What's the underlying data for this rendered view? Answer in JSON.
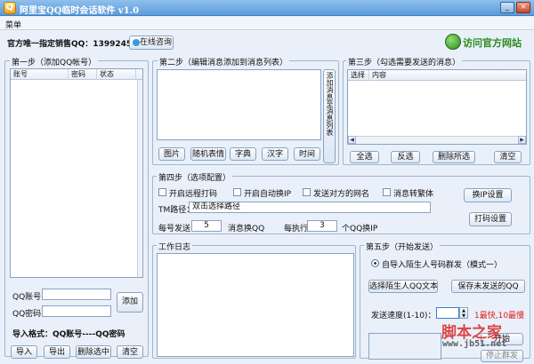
{
  "window": {
    "title": "阿里宝QQ临时会话软件 v1.0",
    "minimize": "_",
    "close": "×"
  },
  "menu": {
    "label": "菜单"
  },
  "toolbar": {
    "official_text": "官方唯一指定销售QQ：1399245890",
    "consult_button": "在线咨询",
    "visit_site": "访问官方网站"
  },
  "step1": {
    "title": "第一步（添加QQ帐号）",
    "columns": [
      "账号",
      "密码",
      "状态"
    ],
    "qq_label": "QQ账号：",
    "pwd_label": "QQ密码：",
    "qq_value": "",
    "pwd_value": "",
    "add_button": "添加",
    "import_format": "导入格式：QQ账号----QQ密码",
    "buttons": [
      "导入",
      "导出",
      "删除选中",
      "清空"
    ]
  },
  "step2": {
    "title": "第二步（编辑消息添加到消息列表）",
    "add_to_list": "添加消息至消息列表",
    "buttons": [
      "图片",
      "随机表情",
      "字典",
      "汉字",
      "时间"
    ]
  },
  "step3": {
    "title": "第三步（勾选需要发送的消息）",
    "columns": [
      "选择",
      "内容"
    ],
    "buttons": [
      "全选",
      "反选",
      "删除所选",
      "清空"
    ]
  },
  "step4": {
    "title": "第四步（选项配置）",
    "options": [
      "开启远程打码",
      "开启自动换IP",
      "发送对方的网名",
      "消息转繁体"
    ],
    "tm_label": "TM路径：",
    "tm_value": "双击选择路径",
    "swap_ip_button": "换IP设置",
    "captcha_button": "打码设置",
    "per_send_label": "每号发送",
    "per_send_value": "5",
    "per_send_unit": "消息换QQ",
    "per_exec_label": "每执行",
    "per_exec_value": "3",
    "per_exec_unit": "个QQ换IP"
  },
  "worklog": {
    "title": "工作日志"
  },
  "step5": {
    "title": "第五步（开始发送）",
    "mode_label": "自导入陌生人号码群发（模式一）",
    "import_button": "选择陌生人QQ文本",
    "save_button": "保存未发送的QQ",
    "speed_label": "发送速度(1-10)：",
    "speed_value": "",
    "speed_hint": "1最快,10最慢",
    "start_button": "开始",
    "stop_button": "停止群发"
  },
  "watermark": {
    "text": "脚本之家",
    "url": "www.jb51.net"
  },
  "colors": {
    "accent": "#2b8a1f",
    "hint": "#e02020",
    "titlebar": "#5b9bd8"
  }
}
